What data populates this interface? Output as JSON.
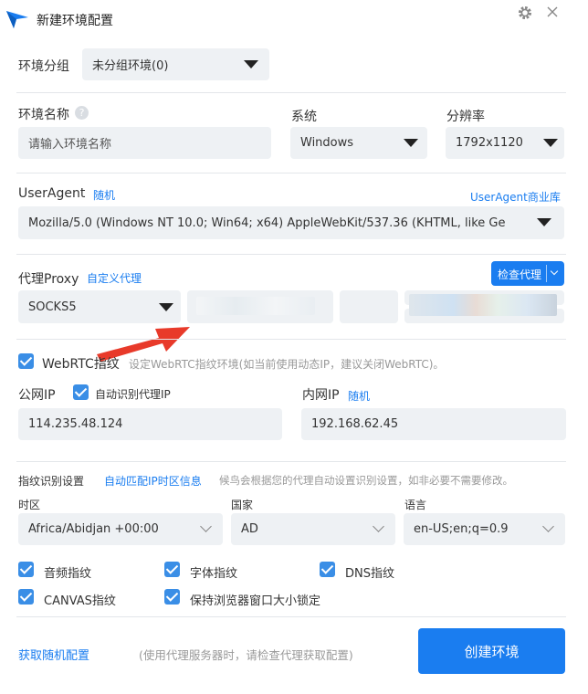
{
  "window": {
    "title": "新建环境配置"
  },
  "group": {
    "label": "环境分组",
    "value": "未分组环境(0)"
  },
  "env_name": {
    "label": "环境名称",
    "placeholder": "请输入环境名称"
  },
  "system": {
    "label": "系统",
    "value": "Windows"
  },
  "resolution": {
    "label": "分辨率",
    "value": "1792x1120"
  },
  "useragent": {
    "label": "UserAgent",
    "random_link": "随机",
    "library_link": "UserAgent商业库",
    "value": "Mozilla/5.0 (Windows NT 10.0; Win64; x64) AppleWebKit/537.36 (KHTML, like Ge"
  },
  "proxy": {
    "label": "代理Proxy",
    "custom_link": "自定义代理",
    "check_button": "检查代理",
    "type": "SOCKS5"
  },
  "webrtc": {
    "label": "WebRTC指纹",
    "hint": "设定WebRTC指纹环境(如当前使用动态IP，建议关闭WebRTC)。"
  },
  "public_ip": {
    "label": "公网IP",
    "auto_label": "自动识别代理IP",
    "value": "114.235.48.124"
  },
  "internal_ip": {
    "label": "内网IP",
    "random_link": "随机",
    "value": "192.168.62.45"
  },
  "fingerprint": {
    "label": "指纹识别设置",
    "auto_link": "自动匹配IP时区信息",
    "hint": "候鸟会根据您的代理自动设置识别设置，如非必要不需要修改。",
    "timezone_label": "时区",
    "timezone_value": "Africa/Abidjan +00:00",
    "country_label": "国家",
    "country_value": "AD",
    "language_label": "语言",
    "language_value": "en-US;en;q=0.9"
  },
  "checks": {
    "audio": "音频指纹",
    "font": "字体指纹",
    "dns": "DNS指纹",
    "canvas": "CANVAS指纹",
    "lock_window": "保持浏览器窗口大小锁定"
  },
  "footer": {
    "random_config": "获取随机配置",
    "note": "(使用代理服务器时，请检查代理获取配置)",
    "create_button": "创建环境"
  },
  "colors": {
    "accent": "#1a7df0",
    "primary_button": "#1a7df0",
    "checkbox": "#3a8ee6",
    "arrow": "#e83a2a"
  }
}
